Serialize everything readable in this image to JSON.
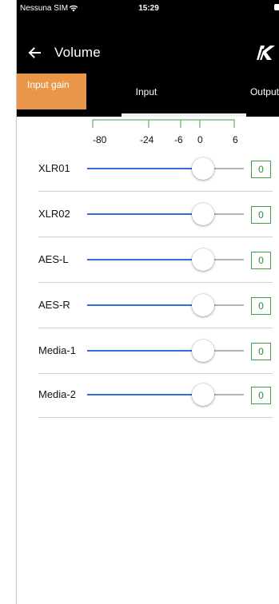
{
  "status_bar": {
    "carrier": "Nessuna SIM",
    "time": "15:29",
    "wifi_icon": "wifi-icon",
    "battery_icon": "battery-icon"
  },
  "nav": {
    "back_icon": "arrow-left-icon",
    "title": "Volume",
    "logo_text": "K",
    "logo_icon": "k-array-logo"
  },
  "tabs": [
    {
      "label": "Input gain",
      "active": true
    },
    {
      "label": "Input",
      "active": false
    },
    {
      "label": "Output",
      "active": false
    }
  ],
  "scale": {
    "ticks": [
      "-80",
      "-24",
      "-6",
      "0",
      "6"
    ],
    "color": "#3f9e4a"
  },
  "channels": [
    {
      "name": "XLR01",
      "value": "0",
      "level": 0.74
    },
    {
      "name": "XLR02",
      "value": "0",
      "level": 0.74
    },
    {
      "name": "AES-L",
      "value": "0",
      "level": 0.74
    },
    {
      "name": "AES-R",
      "value": "0",
      "level": 0.74
    },
    {
      "name": "Media-1",
      "value": "0",
      "level": 0.74
    },
    {
      "name": "Media-2",
      "value": "0",
      "level": 0.74
    }
  ],
  "colors": {
    "accent_tab": "#e8974a",
    "slider_active": "#2f6fd6",
    "slider_inactive": "#b5b5b5",
    "value_green": "#2a8c36",
    "bar_black": "#000000"
  }
}
